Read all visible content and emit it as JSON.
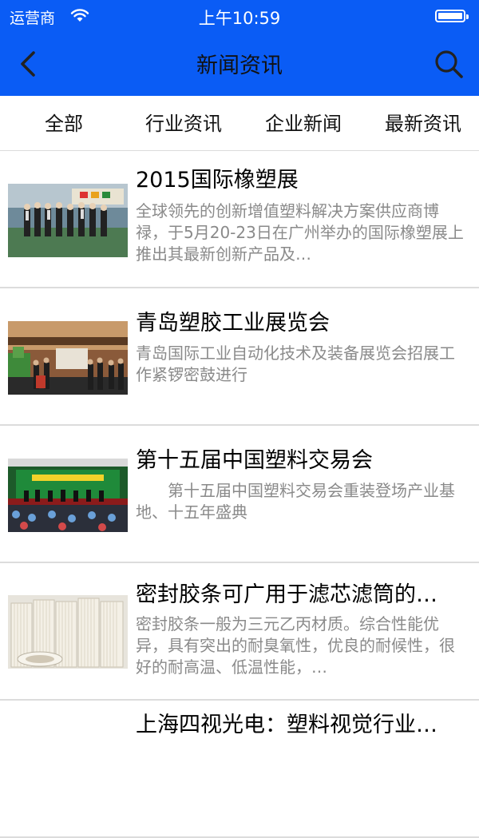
{
  "status": {
    "carrier": "运营商",
    "time": "上午10:59"
  },
  "header": {
    "title": "新闻资讯"
  },
  "tabs": [
    {
      "label": "全部"
    },
    {
      "label": "行业资讯"
    },
    {
      "label": "企业新闻"
    },
    {
      "label": "最新资讯"
    }
  ],
  "news": [
    {
      "title": "2015国际橡塑展",
      "desc": "全球领先的创新增值塑料解决方案供应商博禄，于5月20-23日在广州举办的国际橡塑展上推出其最新创新产品及…"
    },
    {
      "title": "青岛塑胶工业展览会",
      "desc": "青岛国际工业自动化技术及装备展览会招展工作紧锣密鼓进行"
    },
    {
      "title": "第十五届中国塑料交易会",
      "desc": "　　第十五届中国塑料交易会重装登场产业基地、十五年盛典"
    },
    {
      "title": "密封胶条可广用于滤芯滤筒的…",
      "desc": "密封胶条一般为三元乙丙材质。综合性能优异，具有突出的耐臭氧性，优良的耐候性，很好的耐高温、低温性能，…"
    },
    {
      "title": "上海四视光电：塑料视觉行业…",
      "desc": ""
    }
  ],
  "icons": {
    "back": "chevron-left-icon",
    "search": "search-icon",
    "wifi": "wifi-icon",
    "battery": "battery-icon"
  },
  "colors": {
    "header_bg": "#0a5cf5",
    "text_gray": "#8a8a8a",
    "divider": "#dcdcdc"
  }
}
